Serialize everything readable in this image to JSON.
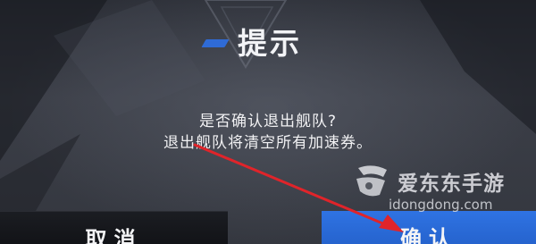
{
  "dialog": {
    "title": "提示",
    "message_line1": "是否确认退出舰队?",
    "message_line2": "退出舰队将清空所有加速券。",
    "cancel_label": "取消",
    "confirm_label": "确认"
  },
  "watermark": {
    "name": "爱东东手游",
    "url": "idongdong.com"
  },
  "icons": [
    "title-accent-icon",
    "red-arrow-annotation-icon",
    "watermark-logo-icon"
  ],
  "colors": {
    "accent_blue": "#2f6bd6",
    "confirm_button": "#2f73e3",
    "cancel_button": "#16181c",
    "annotation_arrow": "#e0242a",
    "text": "#f1f1f3"
  }
}
